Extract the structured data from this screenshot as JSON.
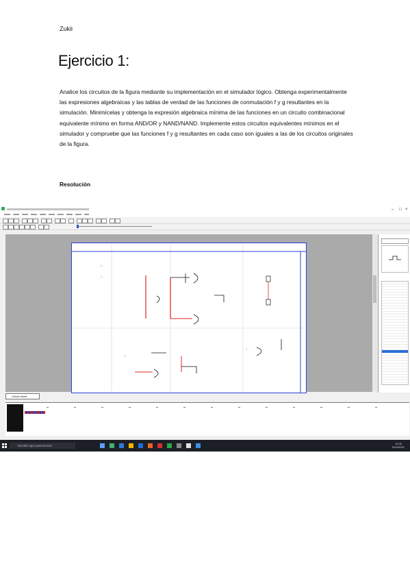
{
  "document": {
    "author": "Zukii",
    "title": "Ejercicio 1:",
    "body": "Analice los circuitos de la figura mediante su implementación en el simulador lógico. Obtenga experimentalmente las expresiones algebraicas y las tablas de verdad de las funciones de conmutación f y g resultantes en la simulación. Minimícelas y obtenga la expresión algebraica mínima de las funciones en un circuito combinacional equivalente mínimo en forma AND/OR y NAND/NAND. Implemente estos circuitos equivalentes mínimos en el simulador y compruebe que las funciones f y g resultantes en cada caso son iguales a las de los circuitos originales de la figura.",
    "section_title": "Resolución"
  },
  "screenshot": {
    "window_buttons": [
      "–",
      "□",
      "×"
    ],
    "sheet_tab_label": "Circuit sheet",
    "search_placeholder": "Escribe aquí para buscar",
    "clock_time": "11:05",
    "clock_date": "5/10/2021",
    "colors": {
      "sheet_border": "#2a3fd8",
      "wire_black": "#111111",
      "wire_red": "#e02020",
      "label_pink": "#e040c0",
      "taskbar": "#1d1f26",
      "canvas_background": "#aaaaaa"
    }
  }
}
